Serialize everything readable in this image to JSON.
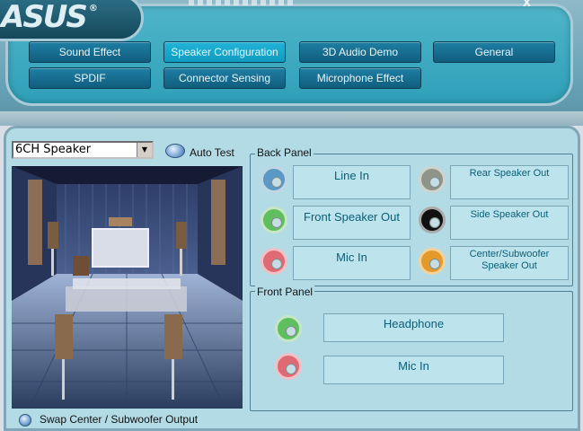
{
  "header": {
    "logo_text": "ASUS",
    "logo_reg": "®",
    "close_glyph": "x",
    "tabs": [
      {
        "label": "Sound Effect",
        "active": false
      },
      {
        "label": "Speaker Configuration",
        "active": true
      },
      {
        "label": "3D Audio Demo",
        "active": false
      },
      {
        "label": "General",
        "active": false
      },
      {
        "label": "SPDIF",
        "active": false
      },
      {
        "label": "Connector Sensing",
        "active": false
      },
      {
        "label": "Microphone Effect",
        "active": false
      }
    ]
  },
  "speaker": {
    "selected_mode": "6CH Speaker",
    "auto_test_label": "Auto Test",
    "swap_label": "Swap Center / Subwoofer Output"
  },
  "back_panel": {
    "title": "Back Panel",
    "ports": [
      {
        "label": "Line In",
        "color": "#5a98c8"
      },
      {
        "label": "Front Speaker Out",
        "color": "#5fbf5f"
      },
      {
        "label": "Mic In",
        "color": "#e06a74"
      },
      {
        "label": "Rear Speaker Out",
        "color": "#8e9488"
      },
      {
        "label": "Side Speaker Out",
        "color": "#111111"
      },
      {
        "label": "Center/Subwoofer Speaker Out",
        "color": "#e39a2a"
      }
    ]
  },
  "front_panel": {
    "title": "Front Panel",
    "ports": [
      {
        "label": "Headphone",
        "color": "#5fbf5f"
      },
      {
        "label": "Mic In",
        "color": "#e06a74"
      }
    ]
  },
  "colors": {
    "accent": "#119bc0",
    "panel_bg": "#b3dbe6",
    "label_text": "#0a5f78"
  }
}
